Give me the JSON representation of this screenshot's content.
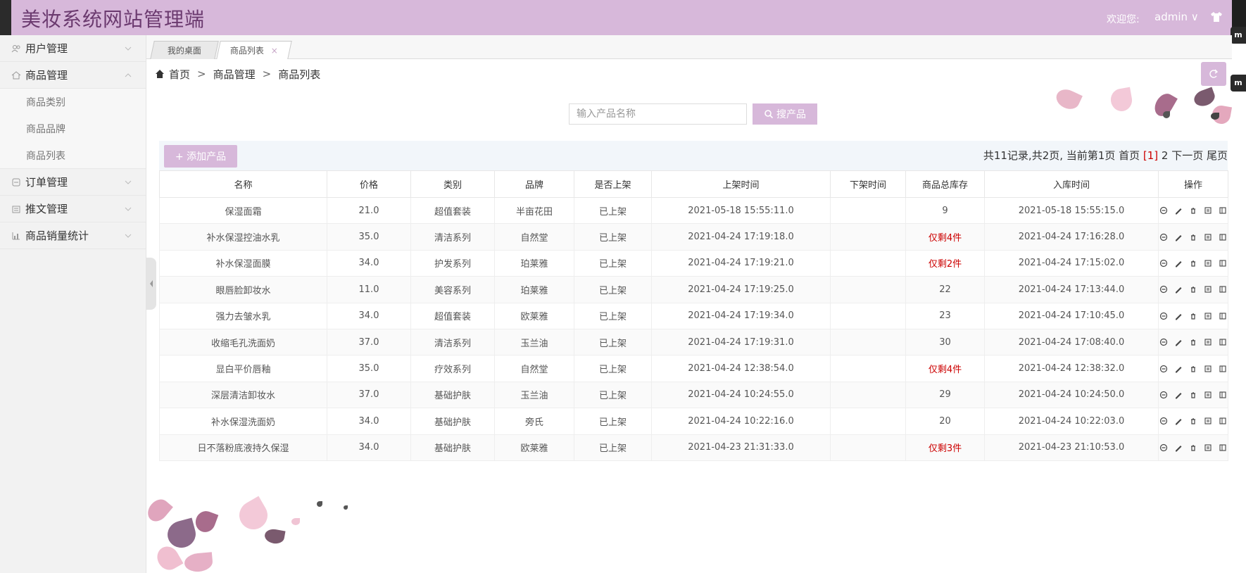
{
  "header": {
    "title": "美妆系统网站管理端",
    "welcome": "欢迎您:",
    "username": "admin ∨",
    "side_widget_label": "m"
  },
  "sidebar": {
    "items": [
      {
        "label": "用户管理",
        "icon": "users-icon"
      },
      {
        "label": "商品管理",
        "icon": "home-icon",
        "expanded": true,
        "children": [
          "商品类别",
          "商品品牌",
          "商品列表"
        ]
      },
      {
        "label": "订单管理",
        "icon": "order-icon"
      },
      {
        "label": "推文管理",
        "icon": "article-icon"
      },
      {
        "label": "商品销量统计",
        "icon": "chart-icon"
      }
    ]
  },
  "tabs": [
    {
      "label": "我的桌面"
    },
    {
      "label": "商品列表",
      "close": "×"
    }
  ],
  "breadcrumb": {
    "home": "首页",
    "sep": ">",
    "level2": "商品管理",
    "level3": "商品列表"
  },
  "search": {
    "placeholder": "输入产品名称",
    "button": "搜产品"
  },
  "add_button": "+ 添加产品",
  "pagination": {
    "prefix": "共11记录,共2页, 当前第1页 首页",
    "current": "[1]",
    "suffix": "2 下一页 尾页"
  },
  "table": {
    "columns": [
      "名称",
      "价格",
      "类别",
      "品牌",
      "是否上架",
      "上架时间",
      "下架时间",
      "商品总库存",
      "入库时间",
      "操作"
    ],
    "rows": [
      {
        "name": "保湿面霜",
        "price": "21.0",
        "category": "超值套装",
        "brand": "半亩花田",
        "status": "已上架",
        "on_time": "2021-05-18 15:55:11.0",
        "off_time": "",
        "stock": "9",
        "low": false,
        "in_time": "2021-05-18 15:55:15.0"
      },
      {
        "name": "补水保湿控油水乳",
        "price": "35.0",
        "category": "清洁系列",
        "brand": "自然堂",
        "status": "已上架",
        "on_time": "2021-04-24 17:19:18.0",
        "off_time": "",
        "stock": "仅剩4件",
        "low": true,
        "in_time": "2021-04-24 17:16:28.0"
      },
      {
        "name": "补水保湿面膜",
        "price": "34.0",
        "category": "护发系列",
        "brand": "珀莱雅",
        "status": "已上架",
        "on_time": "2021-04-24 17:19:21.0",
        "off_time": "",
        "stock": "仅剩2件",
        "low": true,
        "in_time": "2021-04-24 17:15:02.0"
      },
      {
        "name": "眼唇脸卸妆水",
        "price": "11.0",
        "category": "美容系列",
        "brand": "珀莱雅",
        "status": "已上架",
        "on_time": "2021-04-24 17:19:25.0",
        "off_time": "",
        "stock": "22",
        "low": false,
        "in_time": "2021-04-24 17:13:44.0"
      },
      {
        "name": "强力去皱水乳",
        "price": "34.0",
        "category": "超值套装",
        "brand": "欧莱雅",
        "status": "已上架",
        "on_time": "2021-04-24 17:19:34.0",
        "off_time": "",
        "stock": "23",
        "low": false,
        "in_time": "2021-04-24 17:10:45.0"
      },
      {
        "name": "收缩毛孔洗面奶",
        "price": "37.0",
        "category": "清洁系列",
        "brand": "玉兰油",
        "status": "已上架",
        "on_time": "2021-04-24 17:19:31.0",
        "off_time": "",
        "stock": "30",
        "low": false,
        "in_time": "2021-04-24 17:08:40.0"
      },
      {
        "name": "显白平价唇釉",
        "price": "35.0",
        "category": "疗效系列",
        "brand": "自然堂",
        "status": "已上架",
        "on_time": "2021-04-24 12:38:54.0",
        "off_time": "",
        "stock": "仅剩4件",
        "low": true,
        "in_time": "2021-04-24 12:38:32.0"
      },
      {
        "name": "深层清洁卸妆水",
        "price": "37.0",
        "category": "基础护肤",
        "brand": "玉兰油",
        "status": "已上架",
        "on_time": "2021-04-24 10:24:55.0",
        "off_time": "",
        "stock": "29",
        "low": false,
        "in_time": "2021-04-24 10:24:50.0"
      },
      {
        "name": "补水保湿洗面奶",
        "price": "34.0",
        "category": "基础护肤",
        "brand": "旁氏",
        "status": "已上架",
        "on_time": "2021-04-24 10:22:16.0",
        "off_time": "",
        "stock": "20",
        "low": false,
        "in_time": "2021-04-24 10:22:03.0"
      },
      {
        "name": "日不落粉底液持久保湿",
        "price": "34.0",
        "category": "基础护肤",
        "brand": "欧莱雅",
        "status": "已上架",
        "on_time": "2021-04-23 21:31:33.0",
        "off_time": "",
        "stock": "仅剩3件",
        "low": true,
        "in_time": "2021-04-23 21:10:53.0"
      }
    ],
    "row_actions": [
      "disable-icon",
      "edit-icon",
      "delete-icon",
      "detail-icon",
      "copy-icon"
    ]
  },
  "colors": {
    "accent": "#d7b8da",
    "title": "#6b3a6f",
    "warning": "#cc0000"
  }
}
